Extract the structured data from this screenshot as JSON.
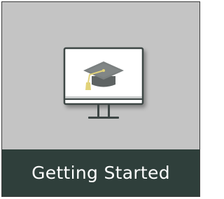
{
  "tile": {
    "title": "Getting Started",
    "icon": "graduation-cap-monitor-icon"
  },
  "colors": {
    "tile_background": "#c4c4c4",
    "caption_bar": "#2f3f3b",
    "caption_text": "#ffffff",
    "monitor_frame": "#3d4645",
    "cap": "#6f7373",
    "tassel": "#e2d37a"
  }
}
